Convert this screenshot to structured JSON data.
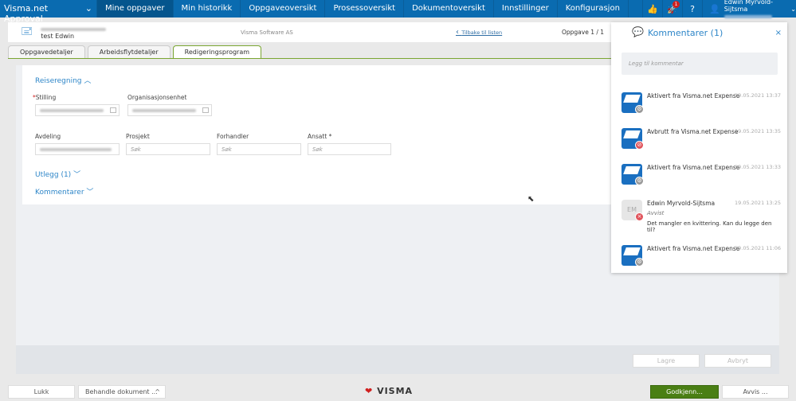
{
  "nav": {
    "brand": "Visma.net Approval",
    "items": [
      "Mine oppgaver",
      "Min historikk",
      "Oppgaveoversikt",
      "Prosessoversikt",
      "Dokumentoversikt",
      "Innstillinger",
      "Konfigurasjon"
    ],
    "notification_count": "1",
    "user_name": "Edwin Myrvold-Sijtsma"
  },
  "header": {
    "subtitle": "test Edwin",
    "company": "Visma Software AS",
    "back_link": "Tilbake til listen",
    "task_counter": "Oppgave 1 / 1"
  },
  "tabs": [
    "Oppgavedetaljer",
    "Arbeidsflytdetaljer",
    "Redigeringsprogram"
  ],
  "form": {
    "section": "Reiseregning",
    "stilling_req": "*",
    "stilling": "Stilling",
    "org": "Organisasjonsenhet",
    "avdeling": "Avdeling",
    "prosjekt": "Prosjekt",
    "forhandler": "Forhandler",
    "ansatt": "Ansatt *",
    "placeholder": "Søk",
    "utlegg": "Utlegg (1)",
    "kommentarer": "Kommentarer"
  },
  "form_footer": {
    "save": "Lagre",
    "cancel": "Avbryt"
  },
  "bottom": {
    "close": "Lukk",
    "process": "Behandle dokument ...",
    "approve": "Godkjenn...",
    "reject": "Avvis ...",
    "logo": "VISMA"
  },
  "comments": {
    "title": "Kommentarer (1)",
    "placeholder": "Legg til kommentar",
    "items": [
      {
        "text": "Aktivert fra Visma.net Expense",
        "date": "19.05.2021 13:37",
        "status": "gear"
      },
      {
        "text": "Avbrutt fra Visma.net Expense",
        "date": "19.05.2021 13:35",
        "status": "cancel"
      },
      {
        "text": "Aktivert fra Visma.net Expense",
        "date": "19.05.2021 13:33",
        "status": "gear"
      },
      {
        "text": "Edwin Myrvold-Sijtsma",
        "date": "19.05.2021 13:25",
        "initials": "EM",
        "action": "Avvist",
        "message": "Det mangler en kvittering. Kan du legge den til?",
        "status": "reject"
      },
      {
        "text": "Aktivert fra Visma.net Expense",
        "date": "19.05.2021 11:06",
        "status": "gear"
      }
    ]
  },
  "colors": {
    "nav": "#0a6bb0",
    "accent": "#2e86c8",
    "approve": "#4a7f14",
    "tab_border": "#7aa632"
  }
}
